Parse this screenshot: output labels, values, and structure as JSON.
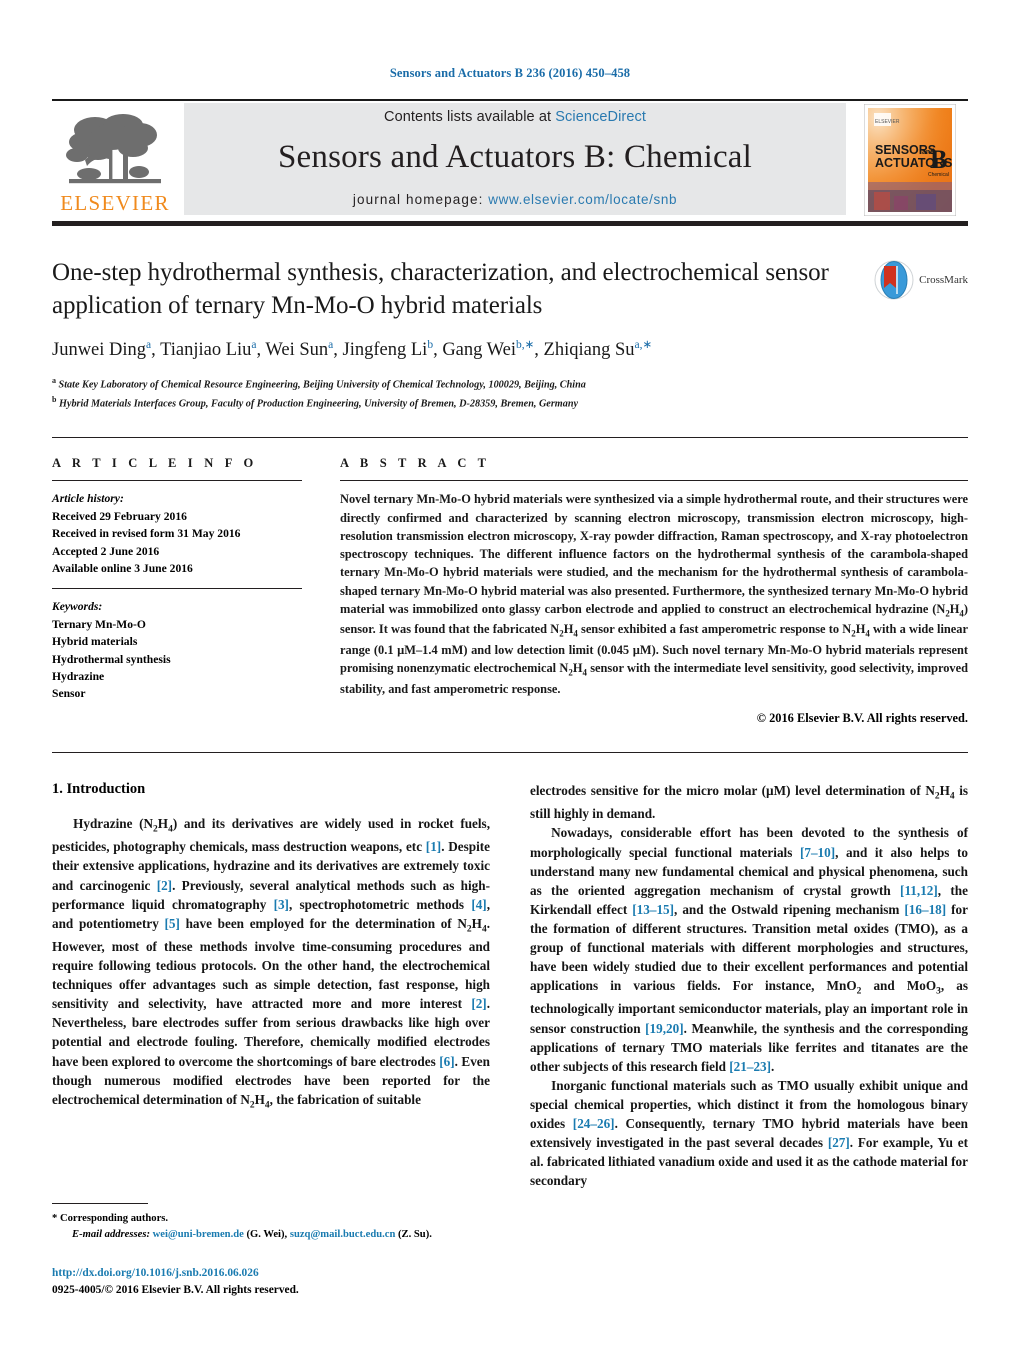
{
  "running_head": "Sensors and Actuators B 236 (2016) 450–458",
  "masthead": {
    "contents_text": "Contents lists available at ",
    "sciencedirect": "ScienceDirect",
    "journal_title": "Sensors and Actuators B: Chemical",
    "homepage_label": "journal homepage: ",
    "homepage_url": "www.elsevier.com/locate/snb",
    "publisher_logo_text": "ELSEVIER",
    "cover_line1": "SENSORS",
    "cover_and": "and",
    "cover_line2": "ACTUATORS",
    "cover_letter": "B",
    "cover_sub": "Chemical",
    "accent_blue": "#2a7ab0",
    "elsevier_orange": "#f08a1d",
    "banner_gray": "#e6e7e8"
  },
  "article": {
    "title": "One-step hydrothermal synthesis, characterization, and electrochemical sensor application of ternary Mn-Mo-O hybrid materials",
    "crossmark_label": "CrossMark",
    "authors_html": "Junwei Ding<sup>a</sup>, Tianjiao Liu<sup>a</sup>, Wei Sun<sup>a</sup>, Jingfeng Li<sup>b</sup>, Gang Wei<sup>b,<span class=\"star\">∗</span></sup>, Zhiqiang Su<sup>a,<span class=\"star\">∗</span></sup>",
    "affiliation_a": "State Key Laboratory of Chemical Resource Engineering, Beijing University of Chemical Technology, 100029, Beijing, China",
    "affiliation_b": "Hybrid Materials Interfaces Group, Faculty of Production Engineering, University of Bremen, D-28359, Bremen, Germany"
  },
  "article_info": {
    "heading": "A R T I C L E  I N F O",
    "history_label": "Article history:",
    "history": [
      "Received 29 February 2016",
      "Received in revised form 31 May 2016",
      "Accepted 2 June 2016",
      "Available online 3 June 2016"
    ],
    "keywords_label": "Keywords:",
    "keywords": [
      "Ternary Mn-Mo-O",
      "Hybrid materials",
      "Hydrothermal synthesis",
      "Hydrazine",
      "Sensor"
    ]
  },
  "abstract": {
    "heading": "A B S T R A C T",
    "body_html": "Novel ternary Mn-Mo-O hybrid materials were synthesized via a simple hydrothermal route, and their structures were directly confirmed and characterized by scanning electron microscopy, transmission electron microscopy, high-resolution transmission electron microscopy, X-ray powder diffraction, Raman spectroscopy, and X-ray photoelectron spectroscopy techniques. The different influence factors on the hydrothermal synthesis of the carambola-shaped ternary Mn-Mo-O hybrid materials were studied, and the mechanism for the hydrothermal synthesis of carambola-shaped ternary Mn-Mo-O hybrid material was also presented. Furthermore, the synthesized ternary Mn-Mo-O hybrid material was immobilized onto glassy carbon electrode and applied to construct an electrochemical hydrazine (N<sub>2</sub>H<sub>4</sub>) sensor. It was found that the fabricated N<sub>2</sub>H<sub>4</sub> sensor exhibited a fast amperometric response to N<sub>2</sub>H<sub>4</sub> with a wide linear range (0.1 &#181;M&#8211;1.4 mM) and low detection limit (0.045 &#181;M). Such novel ternary Mn-Mo-O hybrid materials represent promising nonenzymatic electrochemical N<sub>2</sub>H<sub>4</sub> sensor with the intermediate level sensitivity, good selectivity, improved stability, and fast amperometric response.",
    "copyright": "© 2016 Elsevier B.V. All rights reserved."
  },
  "body": {
    "section_heading": "1.  Introduction",
    "left_paragraphs_html": [
      "Hydrazine (N<sub>2</sub>H<sub>4</sub>) and its derivatives are widely used in rocket fuels, pesticides, photography chemicals, mass destruction weapons, etc <span class=\"ref\">[1]</span>. Despite their extensive applications, hydrazine and its derivatives are extremely toxic and carcinogenic <span class=\"ref\">[2]</span>. Previously, several analytical methods such as high-performance liquid chromatography <span class=\"ref\">[3]</span>, spectrophotometric methods <span class=\"ref\">[4]</span>, and potentiometry <span class=\"ref\">[5]</span> have been employed for the determination of N<sub>2</sub>H<sub>4</sub>. However, most of these methods involve time-consuming procedures and require following tedious protocols. On the other hand, the electrochemical techniques offer advantages such as simple detection, fast response, high sensitivity and selectivity, have attracted more and more interest <span class=\"ref\">[2]</span>. Nevertheless, bare electrodes suffer from serious drawbacks like high over potential and electrode fouling. Therefore, chemically modified electrodes have been explored to overcome the shortcomings of bare electrodes <span class=\"ref\">[6]</span>. Even though numerous modified electrodes have been reported for the electrochemical determination of N<sub>2</sub>H<sub>4</sub>, the fabrication of suitable"
    ],
    "right_paragraphs_html": [
      "electrodes sensitive for the micro molar (&#181;M) level determination of N<sub>2</sub>H<sub>4</sub> is still highly in demand.",
      "Nowadays, considerable effort has been devoted to the synthesis of morphologically special functional materials <span class=\"ref\">[7&#8211;10]</span>, and it also helps to understand many new fundamental chemical and physical phenomena, such as the oriented aggregation mechanism of crystal growth <span class=\"ref\">[11,12]</span>, the Kirkendall effect <span class=\"ref\">[13&#8211;15]</span>, and the Ostwald ripening mechanism <span class=\"ref\">[16&#8211;18]</span> for the formation of different structures. Transition metal oxides (TMO), as a group of functional materials with different morphologies and structures, have been widely studied due to their excellent performances and potential applications in various fields. For instance, MnO<sub>2</sub> and MoO<sub>3</sub>, as technologically important semiconductor materials, play an important role in sensor construction <span class=\"ref\">[19,20]</span>. Meanwhile, the synthesis and the corresponding applications of ternary TMO materials like ferrites and titanates are the other subjects of this research field <span class=\"ref\">[21&#8211;23]</span>.",
      "Inorganic functional materials such as TMO usually exhibit unique and special chemical properties, which distinct it from the homologous binary oxides <span class=\"ref\">[24&#8211;26]</span>. Consequently, ternary TMO hybrid materials have been extensively investigated in the past several decades <span class=\"ref\">[27]</span>. For example, Yu et al. fabricated lithiated vanadium oxide and used it as the cathode material for secondary"
    ]
  },
  "footer": {
    "corresponding_marker": "*",
    "corresponding_label": "Corresponding authors.",
    "email_label": "E-mail addresses:",
    "email_1": "wei@uni-bremen.de",
    "email_1_owner": "(G. Wei),",
    "email_2": "suzq@mail.buct.edu.cn",
    "email_2_owner": "(Z. Su).",
    "doi": "http://dx.doi.org/10.1016/j.snb.2016.06.026",
    "issn_line": "0925-4005/© 2016 Elsevier B.V. All rights reserved."
  }
}
